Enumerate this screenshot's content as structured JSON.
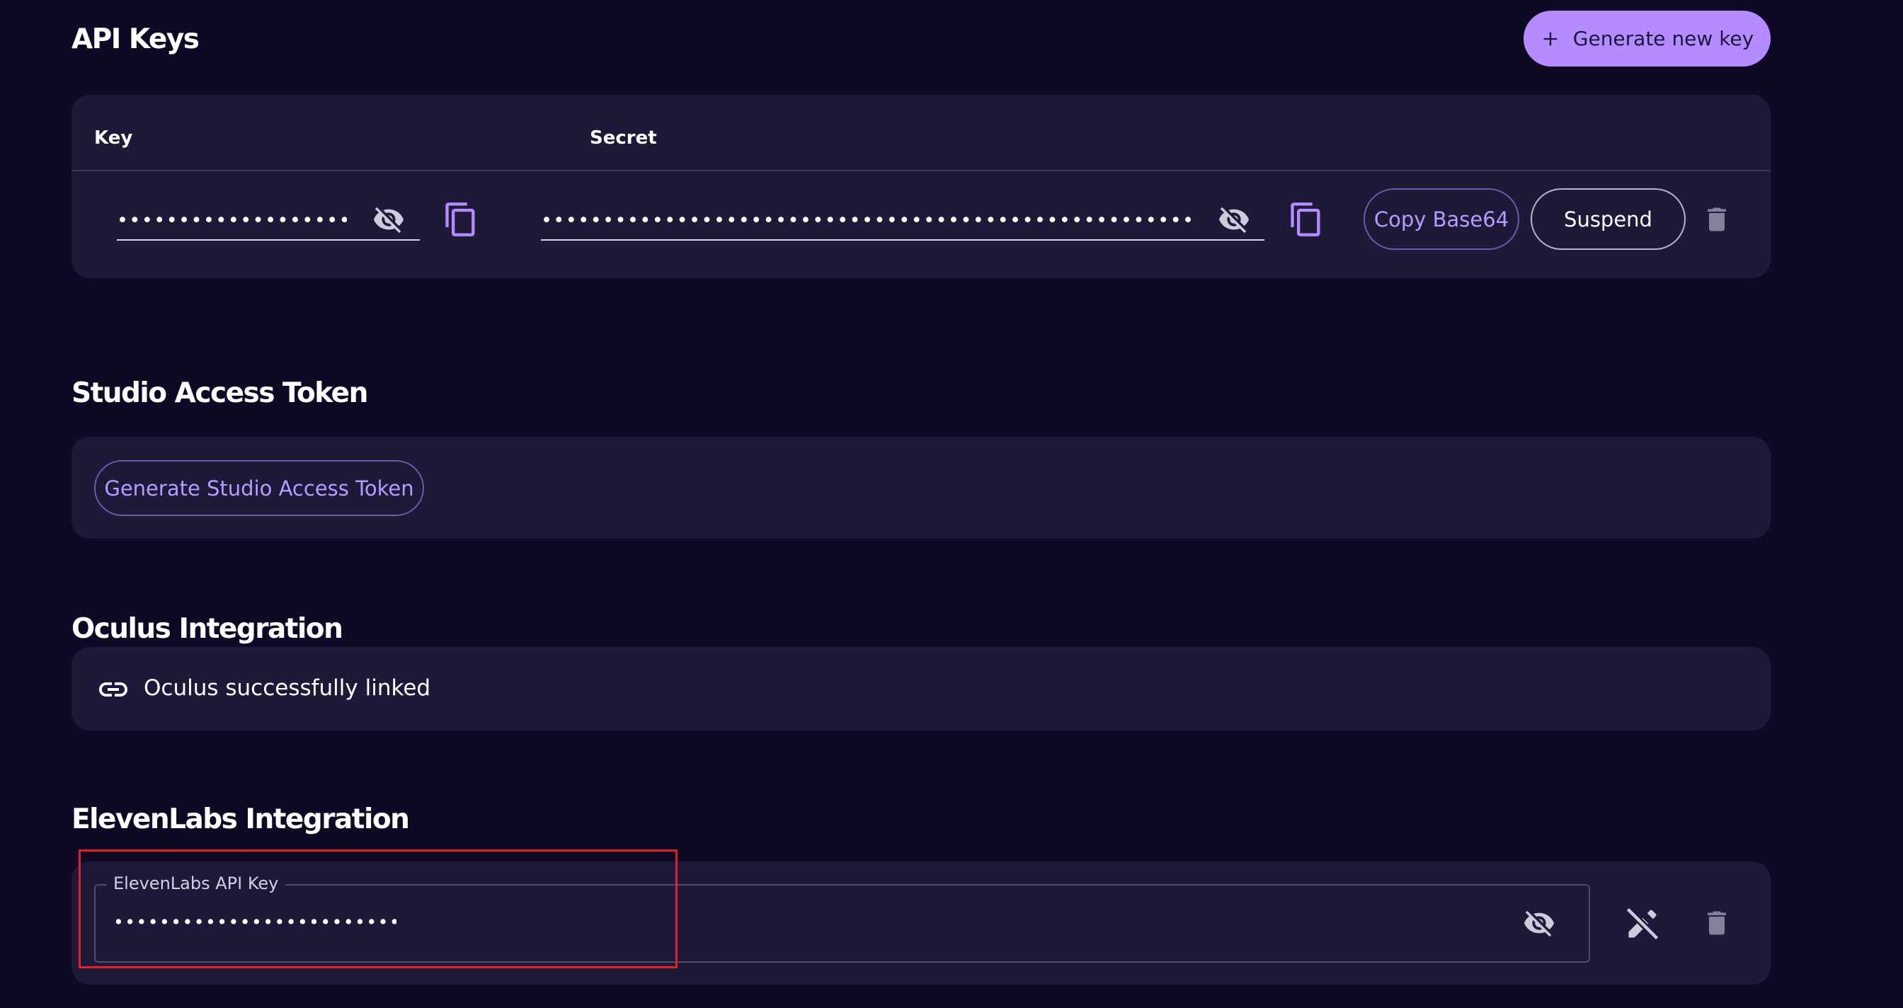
{
  "api_keys": {
    "title": "API Keys",
    "generate_button": "Generate new key",
    "columns": {
      "key": "Key",
      "secret": "Secret"
    },
    "row": {
      "key_masked": "••••••••••••••••••••••••••",
      "secret_masked": "••••••••••••••••••••••••••••••••••••••••••••••••••••••••••••••••••••••",
      "copy_base64": "Copy Base64",
      "suspend": "Suspend"
    }
  },
  "studio": {
    "title": "Studio Access Token",
    "generate_button": "Generate Studio Access Token"
  },
  "oculus": {
    "title": "Oculus Integration",
    "status": "Oculus successfully linked"
  },
  "elevenlabs": {
    "title": "ElevenLabs Integration",
    "field_label": "ElevenLabs API Key",
    "field_value": "••••••••••••••••••••••••••••••"
  },
  "icons": {
    "add": "plus-icon",
    "visibility_off": "eye-off-icon",
    "copy": "copy-icon",
    "delete": "trash-icon",
    "link": "link-icon",
    "edit_off": "edit-off-icon"
  },
  "colors": {
    "background": "#0e0a26",
    "card": "#1e1938",
    "accent": "#b48cff",
    "accent_text": "#b79cff",
    "highlight": "#e0212a"
  }
}
